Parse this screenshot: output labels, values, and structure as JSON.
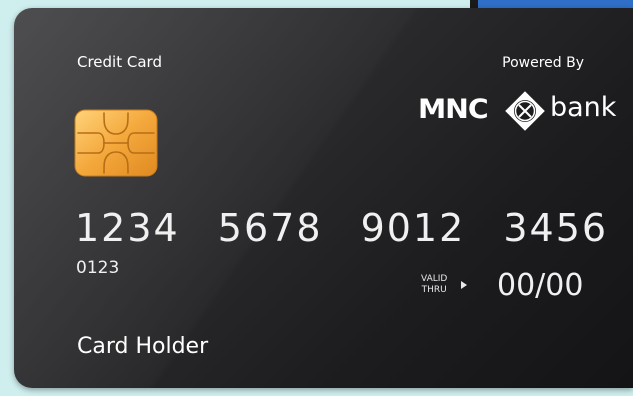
{
  "card": {
    "type_label": "Credit Card",
    "powered_by": "Powered By",
    "brand": {
      "mnc": "MNC",
      "bank": "bank"
    },
    "number": "1234 5678 9012 3456",
    "small_number": "0123",
    "valid_thru_line1": "VALID",
    "valid_thru_line2": "THRU",
    "expiry": "00/00",
    "holder": "Card Holder",
    "colors": {
      "card": "#2b2b2d",
      "chip": "#f2a93b",
      "background": "#cfeeee",
      "accent_panel": "#2f6fc8"
    },
    "icons": [
      "chip-icon",
      "mnc-bank-x-logo-icon",
      "play-arrow-icon"
    ]
  }
}
